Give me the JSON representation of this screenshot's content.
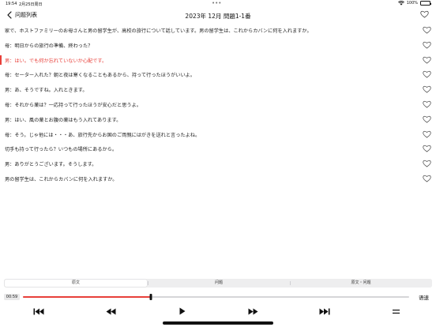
{
  "status_bar": {
    "time": "19:54",
    "date": "2月25日周日",
    "battery": "100%"
  },
  "nav": {
    "back_label": "问题列表",
    "title": "2023年 12月 問題1-1番"
  },
  "sentences": [
    {
      "text": "家で、ホストファミリーのお母さんと男の留学生が、高校の旅行について話しています。男の留学生は、これからカバンに何を入れますか。",
      "active": false
    },
    {
      "text": "母：明日からの旅行の準備、終わった？",
      "active": false
    },
    {
      "text": "男：はい。でも何か忘れていないか心配です。",
      "active": true
    },
    {
      "text": "母：セーター入れた？朝と夜は寒くなることもあるから、持って行ったほうがいいよ。",
      "active": false
    },
    {
      "text": "男：あ、そうですね。入れときます。",
      "active": false
    },
    {
      "text": "母：それから薬は？一応持って行ったほうが安心だと思うよ。",
      "active": false
    },
    {
      "text": "男：はい、風の薬とお腹の薬はもう入れてあります。",
      "active": false
    },
    {
      "text": "母：そう。じゃ他には・・・あ、旅行先からお国のご両親にはがきを送れと言ったよね。",
      "active": false
    },
    {
      "text": "切手も持って行ったら？いつもの場所にあるから。",
      "active": false
    },
    {
      "text": "男：ありがとうございます。そうします。",
      "active": false
    },
    {
      "text": "男の留学生は、これからカバンに何を入れますか。",
      "active": false
    }
  ],
  "tabs": [
    {
      "label": "原文",
      "selected": true
    },
    {
      "label": "问题",
      "selected": false
    },
    {
      "label": "原文・问题",
      "selected": false
    }
  ],
  "player": {
    "current_time": "00:59",
    "progress": 0.331,
    "speed_label": "语速"
  },
  "icons": {
    "back": "chevron-left-icon",
    "favorite": "heart-outline-icon",
    "skip_back": "skip-back-icon",
    "rewind": "rewind-icon",
    "play": "play-icon",
    "fast_forward": "fast-forward-icon",
    "skip_forward": "skip-forward-icon",
    "menu": "menu-icon"
  },
  "colors": {
    "accent": "#e8403a",
    "text": "#222222",
    "tab_bg": "#eeeeef"
  }
}
